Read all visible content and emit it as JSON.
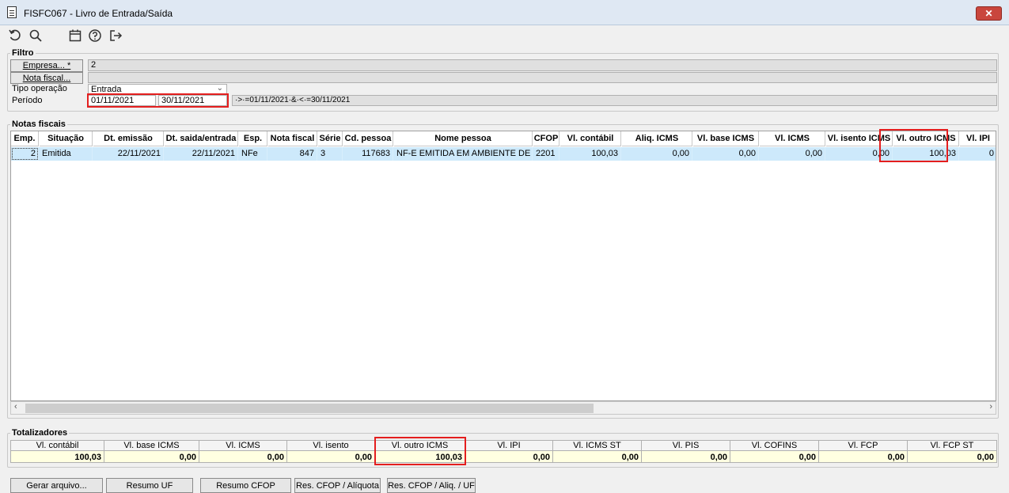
{
  "window": {
    "title": "FISFC067 - Livro de Entrada/Saída",
    "close_symbol": "✕"
  },
  "toolbar": {
    "icons": [
      "undo-icon",
      "search-icon",
      "calendar-icon",
      "help-icon",
      "exit-icon"
    ]
  },
  "filtro": {
    "label": "Filtro",
    "empresa_button": "Empresa... *",
    "empresa_value": "2",
    "nota_fiscal_button": "Nota fiscal...",
    "nota_fiscal_value": "",
    "tipo_operacao_label": "Tipo operação",
    "tipo_operacao_value": "Entrada",
    "periodo_label": "Período",
    "periodo_inicio": "01/11/2021",
    "periodo_fim": "30/11/2021",
    "periodo_expr": "·>·=01/11/2021·&·<·=30/11/2021"
  },
  "notas": {
    "label": "Notas fiscais",
    "headers": [
      "Emp.",
      "Situação",
      "Dt. emissão",
      "Dt. saida/entrada",
      "Esp.",
      "Nota fiscal",
      "Série",
      "Cd. pessoa",
      "Nome pessoa",
      "CFOP",
      "Vl. contábil",
      "Aliq. ICMS",
      "Vl. base ICMS",
      "Vl. ICMS",
      "Vl. isento ICMS",
      "Vl. outro ICMS",
      "Vl. IPI"
    ],
    "row": [
      "2",
      "Emitida",
      "22/11/2021",
      "22/11/2021",
      "NFe",
      "847",
      "3",
      "117683",
      "NF-E EMITIDA EM AMBIENTE DE HOMOLOGACAO",
      "2201",
      "100,03",
      "0,00",
      "0,00",
      "0,00",
      "0,00",
      "100,03",
      "0"
    ]
  },
  "totalizadores": {
    "label": "Totalizadores",
    "headers": [
      "Vl. contábil",
      "Vl. base ICMS",
      "Vl. ICMS",
      "Vl. isento",
      "Vl. outro ICMS",
      "Vl. IPI",
      "Vl. ICMS ST",
      "Vl. PIS",
      "Vl. COFINS",
      "Vl. FCP",
      "Vl. FCP ST"
    ],
    "values": [
      "100,03",
      "0,00",
      "0,00",
      "0,00",
      "100,03",
      "0,00",
      "0,00",
      "0,00",
      "0,00",
      "0,00",
      "0,00"
    ]
  },
  "buttons": {
    "gerar_arquivo": "Gerar arquivo...",
    "resumo_uf": "Resumo UF",
    "resumo_cfop": "Resumo CFOP",
    "res_cfop_aliquota": "Res. CFOP / Alíquota",
    "res_cfop_aliq_uf": "Res. CFOP / Aliq. / UF"
  },
  "colors": {
    "highlight": "#e41e1e",
    "selected_row": "#cde9fb",
    "totals_bg": "#ffffe1"
  }
}
